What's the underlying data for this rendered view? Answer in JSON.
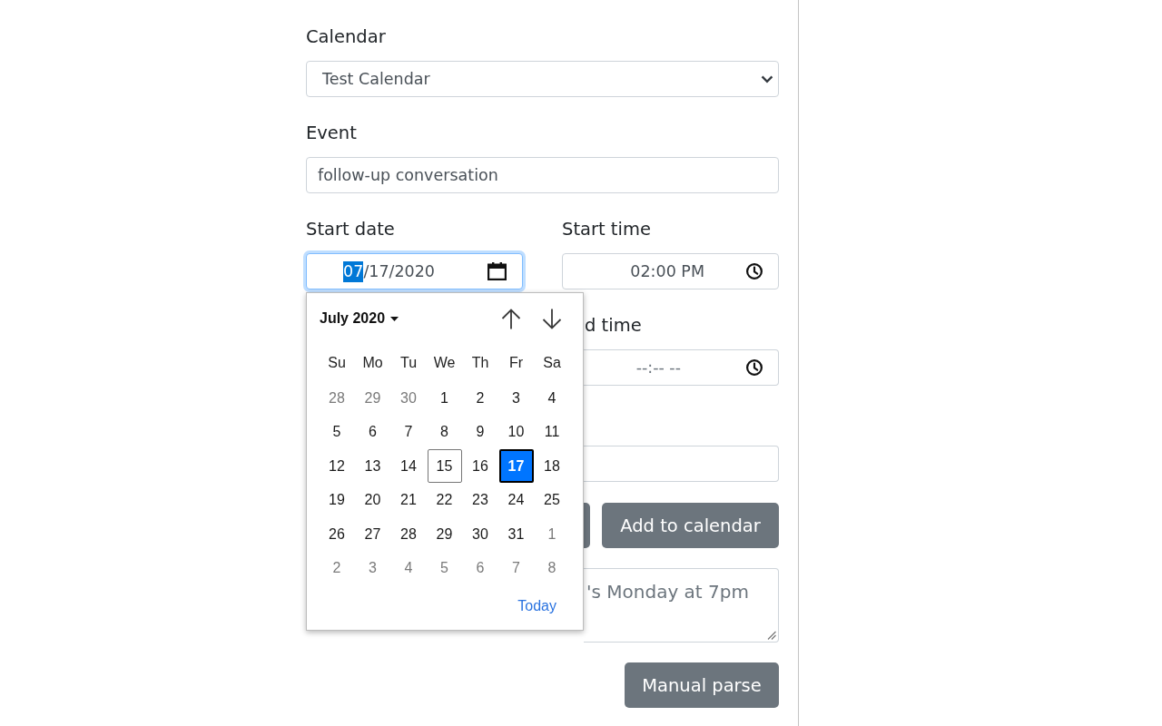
{
  "form": {
    "calendar": {
      "label": "Calendar",
      "value": "Test Calendar"
    },
    "event": {
      "label": "Event",
      "value": "follow-up conversation"
    },
    "start_date": {
      "label": "Start date",
      "focused": true,
      "value_parts": [
        {
          "text": "07",
          "selected": true
        },
        {
          "text": "/17/2020",
          "selected": false
        }
      ]
    },
    "start_time": {
      "label": "Start time",
      "focused": false,
      "value": "02:00 PM"
    },
    "end_time": {
      "label": "d time",
      "placeholder": "--:-- --"
    },
    "field_5": {
      "kind": "text"
    },
    "buttons": [
      {
        "kind": "covered"
      },
      {
        "kind": "labeled",
        "label": "Add to calendar"
      }
    ],
    "notes": {
      "placeholder": "'s Monday at 7pm"
    },
    "manual_parse_button": {
      "label": "Manual parse"
    }
  },
  "date_picker": {
    "month": "July 2020",
    "weekdays": [
      "Su",
      "Mo",
      "Tu",
      "We",
      "Th",
      "Fr",
      "Sa"
    ],
    "weeks": [
      [
        {
          "day": "28",
          "in_month": false,
          "today": false,
          "selected": false
        },
        {
          "day": "29",
          "in_month": false,
          "today": false,
          "selected": false
        },
        {
          "day": "30",
          "in_month": false,
          "today": false,
          "selected": false
        },
        {
          "day": "1",
          "in_month": true,
          "today": false,
          "selected": false
        },
        {
          "day": "2",
          "in_month": true,
          "today": false,
          "selected": false
        },
        {
          "day": "3",
          "in_month": true,
          "today": false,
          "selected": false
        },
        {
          "day": "4",
          "in_month": true,
          "today": false,
          "selected": false
        }
      ],
      [
        {
          "day": "5",
          "in_month": true,
          "today": false,
          "selected": false
        },
        {
          "day": "6",
          "in_month": true,
          "today": false,
          "selected": false
        },
        {
          "day": "7",
          "in_month": true,
          "today": false,
          "selected": false
        },
        {
          "day": "8",
          "in_month": true,
          "today": false,
          "selected": false
        },
        {
          "day": "9",
          "in_month": true,
          "today": false,
          "selected": false
        },
        {
          "day": "10",
          "in_month": true,
          "today": false,
          "selected": false
        },
        {
          "day": "11",
          "in_month": true,
          "today": false,
          "selected": false
        }
      ],
      [
        {
          "day": "12",
          "in_month": true,
          "today": false,
          "selected": false
        },
        {
          "day": "13",
          "in_month": true,
          "today": false,
          "selected": false
        },
        {
          "day": "14",
          "in_month": true,
          "today": false,
          "selected": false
        },
        {
          "day": "15",
          "in_month": true,
          "today": true,
          "selected": false
        },
        {
          "day": "16",
          "in_month": true,
          "today": false,
          "selected": false
        },
        {
          "day": "17",
          "in_month": true,
          "today": false,
          "selected": true
        },
        {
          "day": "18",
          "in_month": true,
          "today": false,
          "selected": false
        }
      ],
      [
        {
          "day": "19",
          "in_month": true,
          "today": false,
          "selected": false
        },
        {
          "day": "20",
          "in_month": true,
          "today": false,
          "selected": false
        },
        {
          "day": "21",
          "in_month": true,
          "today": false,
          "selected": false
        },
        {
          "day": "22",
          "in_month": true,
          "today": false,
          "selected": false
        },
        {
          "day": "23",
          "in_month": true,
          "today": false,
          "selected": false
        },
        {
          "day": "24",
          "in_month": true,
          "today": false,
          "selected": false
        },
        {
          "day": "25",
          "in_month": true,
          "today": false,
          "selected": false
        }
      ],
      [
        {
          "day": "26",
          "in_month": true,
          "today": false,
          "selected": false
        },
        {
          "day": "27",
          "in_month": true,
          "today": false,
          "selected": false
        },
        {
          "day": "28",
          "in_month": true,
          "today": false,
          "selected": false
        },
        {
          "day": "29",
          "in_month": true,
          "today": false,
          "selected": false
        },
        {
          "day": "30",
          "in_month": true,
          "today": false,
          "selected": false
        },
        {
          "day": "31",
          "in_month": true,
          "today": false,
          "selected": false
        },
        {
          "day": "1",
          "in_month": false,
          "today": false,
          "selected": false
        }
      ],
      [
        {
          "day": "2",
          "in_month": false,
          "today": false,
          "selected": false
        },
        {
          "day": "3",
          "in_month": false,
          "today": false,
          "selected": false
        },
        {
          "day": "4",
          "in_month": false,
          "today": false,
          "selected": false
        },
        {
          "day": "5",
          "in_month": false,
          "today": false,
          "selected": false
        },
        {
          "day": "6",
          "in_month": false,
          "today": false,
          "selected": false
        },
        {
          "day": "7",
          "in_month": false,
          "today": false,
          "selected": false
        },
        {
          "day": "8",
          "in_month": false,
          "today": false,
          "selected": false
        }
      ]
    ],
    "today_link": "Today"
  }
}
